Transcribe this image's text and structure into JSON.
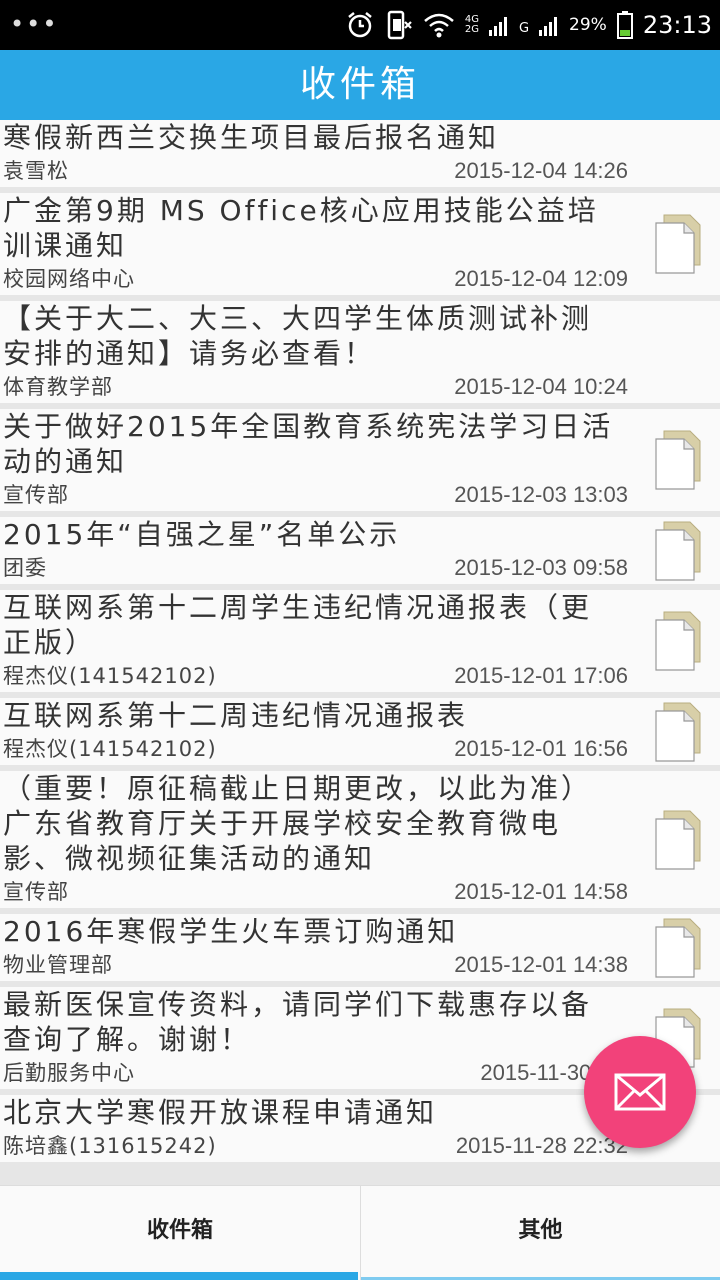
{
  "status_bar": {
    "menu_dots": "•••",
    "network_top": "4G",
    "network_bottom": "2G",
    "signal_g": "G",
    "battery_percent": "29%",
    "time": "23:13"
  },
  "header": {
    "title": "收件箱"
  },
  "inbox": {
    "items": [
      {
        "title": "寒假新西兰交换生项目最后报名通知",
        "sender": "袁雪松",
        "date": "2015-12-04 14:26",
        "has_attachment": false
      },
      {
        "title": "广金第9期 MS Office核心应用技能公益培训课通知",
        "sender": "校园网络中心",
        "date": "2015-12-04 12:09",
        "has_attachment": true
      },
      {
        "title": "【关于大二、大三、大四学生体质测试补测安排的通知】请务必查看！",
        "sender": "体育教学部",
        "date": "2015-12-04 10:24",
        "has_attachment": false
      },
      {
        "title": "关于做好2015年全国教育系统宪法学习日活动的通知",
        "sender": "宣传部",
        "date": "2015-12-03 13:03",
        "has_attachment": true
      },
      {
        "title": "2015年“自强之星”名单公示",
        "sender": "团委",
        "date": "2015-12-03 09:58",
        "has_attachment": true
      },
      {
        "title": "互联网系第十二周学生违纪情况通报表（更正版）",
        "sender": "程杰仪(141542102)",
        "date": "2015-12-01 17:06",
        "has_attachment": true
      },
      {
        "title": "互联网系第十二周违纪情况通报表",
        "sender": "程杰仪(141542102)",
        "date": "2015-12-01 16:56",
        "has_attachment": true
      },
      {
        "title": "（重要！原征稿截止日期更改，以此为准）广东省教育厅关于开展学校安全教育微电影、微视频征集活动的通知",
        "sender": "宣传部",
        "date": "2015-12-01 14:58",
        "has_attachment": true
      },
      {
        "title": "2016年寒假学生火车票订购通知",
        "sender": "物业管理部",
        "date": "2015-12-01 14:38",
        "has_attachment": true
      },
      {
        "title": "最新医保宣传资料，请同学们下载惠存以备查询了解。谢谢！",
        "sender": "后勤服务中心",
        "date": "2015-11-30 14:",
        "has_attachment": true
      },
      {
        "title": "北京大学寒假开放课程申请通知",
        "sender": "陈培鑫(131615242)",
        "date": "2015-11-28 22:32",
        "has_attachment": false
      }
    ]
  },
  "fab": {
    "icon": "mail-icon"
  },
  "tabs": [
    {
      "label": "收件箱",
      "active": true
    },
    {
      "label": "其他",
      "active": false
    }
  ],
  "colors": {
    "accent": "#2aa7e5",
    "fab": "#f2427a",
    "status_bar": "#000000",
    "battery_fill": "#66cc33"
  }
}
